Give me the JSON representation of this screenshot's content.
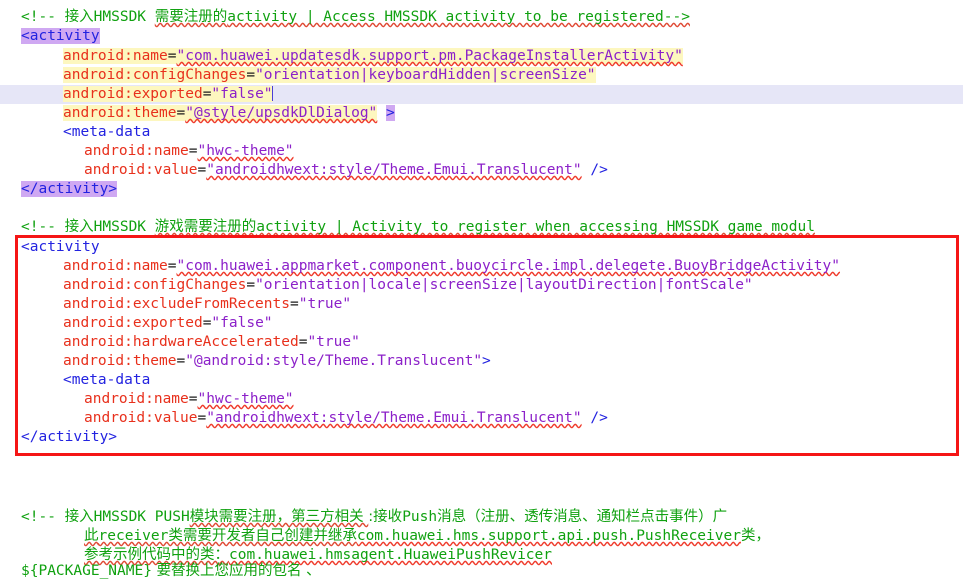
{
  "editor": {
    "type": "xml-code-editor",
    "language": "AndroidManifest.xml",
    "colors": {
      "background": "#ffffff",
      "comment": "#10a110",
      "tag": "#2323e0",
      "attribute": "#e8301c",
      "value": "#8c21c9",
      "search_highlight": "#fdf7bf",
      "bracket_match_highlight": "#cfa8f2",
      "current_line": "#e6e6f7",
      "annotation_box": "#f51616",
      "spellcheck_underline": "#ef3b2c"
    },
    "annotation": {
      "shape": "rectangle",
      "color": "#f51616",
      "name": "red-highlight-box"
    }
  },
  "lines": {
    "l1_comment_open": "<!-- ",
    "l1_cjk_a": "接入",
    "l1_hmssdk": "HMSSDK ",
    "l1_cjk_b": "需要注册的",
    "l1_activity": "activity | Access HMSSDK activity to be registered-->",
    "l2_tag_open": "<activity",
    "l3_attr": "android:name",
    "l3_eq": "=",
    "l3_value": "\"com.huawei.updatesdk.support.pm.PackageInstallerActivity\"",
    "l4_attr": "android:configChanges",
    "l4_eq": "=",
    "l4_value": "\"orientation|keyboardHidden|screenSize\"",
    "l5_attr": "android:exported",
    "l5_eq": "=",
    "l5_value": "\"false\"",
    "l6_attr": "android:theme",
    "l6_eq": "=",
    "l6_value": "\"@style/upsdkDlDialog\"",
    "l6_bracket": ">",
    "l7_tag": "<meta-data",
    "l8_attr": "android:name",
    "l8_eq": "=",
    "l8_value": "\"hwc-theme\"",
    "l9_attr": "android:value",
    "l9_eq": "=",
    "l9_value": "\"androidhwext:style/Theme.Emui.Translucent\"",
    "l9_close": " />",
    "l10_tag_close": "</activity>",
    "l12_comment_open": "<!-- ",
    "l12_cjk_a": "接入",
    "l12_hmssdk": "HMSSDK ",
    "l12_cjk_b": "游戏需要注册的",
    "l12_rest": "activity | Activity to register when accessing HMSSDK game modul",
    "l13_tag_open": "<activity",
    "l14_attr": "android:name",
    "l14_eq": "=",
    "l14_value": "\"com.huawei.appmarket.component.buoycircle.impl.delegete.BuoyBridgeActivity\"",
    "l15_attr": "android:configChanges",
    "l15_eq": "=",
    "l15_value": "\"orientation|locale|screenSize|layoutDirection|fontScale\"",
    "l16_attr": "android:excludeFromRecents",
    "l16_eq": "=",
    "l16_value": "\"true\"",
    "l17_attr": "android:exported",
    "l17_eq": "=",
    "l17_value": "\"false\"",
    "l18_attr": "android:hardwareAccelerated",
    "l18_eq": "=",
    "l18_value": "\"true\"",
    "l19_attr": "android:theme",
    "l19_eq": "=",
    "l19_value": "\"@android:style/Theme.Translucent\"",
    "l19_bracket": ">",
    "l20_tag": "<meta-data",
    "l21_attr": "android:name",
    "l21_eq": "=",
    "l21_value": "\"hwc-theme\"",
    "l22_attr": "android:value",
    "l22_eq": "=",
    "l22_value": "\"androidhwext:style/Theme.Emui.Translucent\"",
    "l22_close": " />",
    "l23_tag_close": "</activity>",
    "l25_a": "<!-- ",
    "l25_cjk_1": "接入",
    "l25_b": "HMSSDK PUSH",
    "l25_cjk_2": "模块需要注册，第三方相关 ",
    "l25_cjk_3": ":接收",
    "l25_push": "Push",
    "l25_cjk_4": "消息（注册、透传消息、通知栏点击事件）广",
    "l26_cjk_1": "此",
    "l26_receiver": "receiver",
    "l26_cjk_2": "类需要开发者自己创建并继承",
    "l26_class": "com.huawei.hms.support.api.push.PushReceiver",
    "l26_cjk_3": "类，",
    "l27_cjk_1": "参考示例代码中的类：",
    "l27_class": "com.huawei.hmsagent.HuaweiPushRevicer",
    "l28_var": "${PACKAGE_NAME}",
    "l28_cjk": " 要替换上您应用的包名 、"
  }
}
